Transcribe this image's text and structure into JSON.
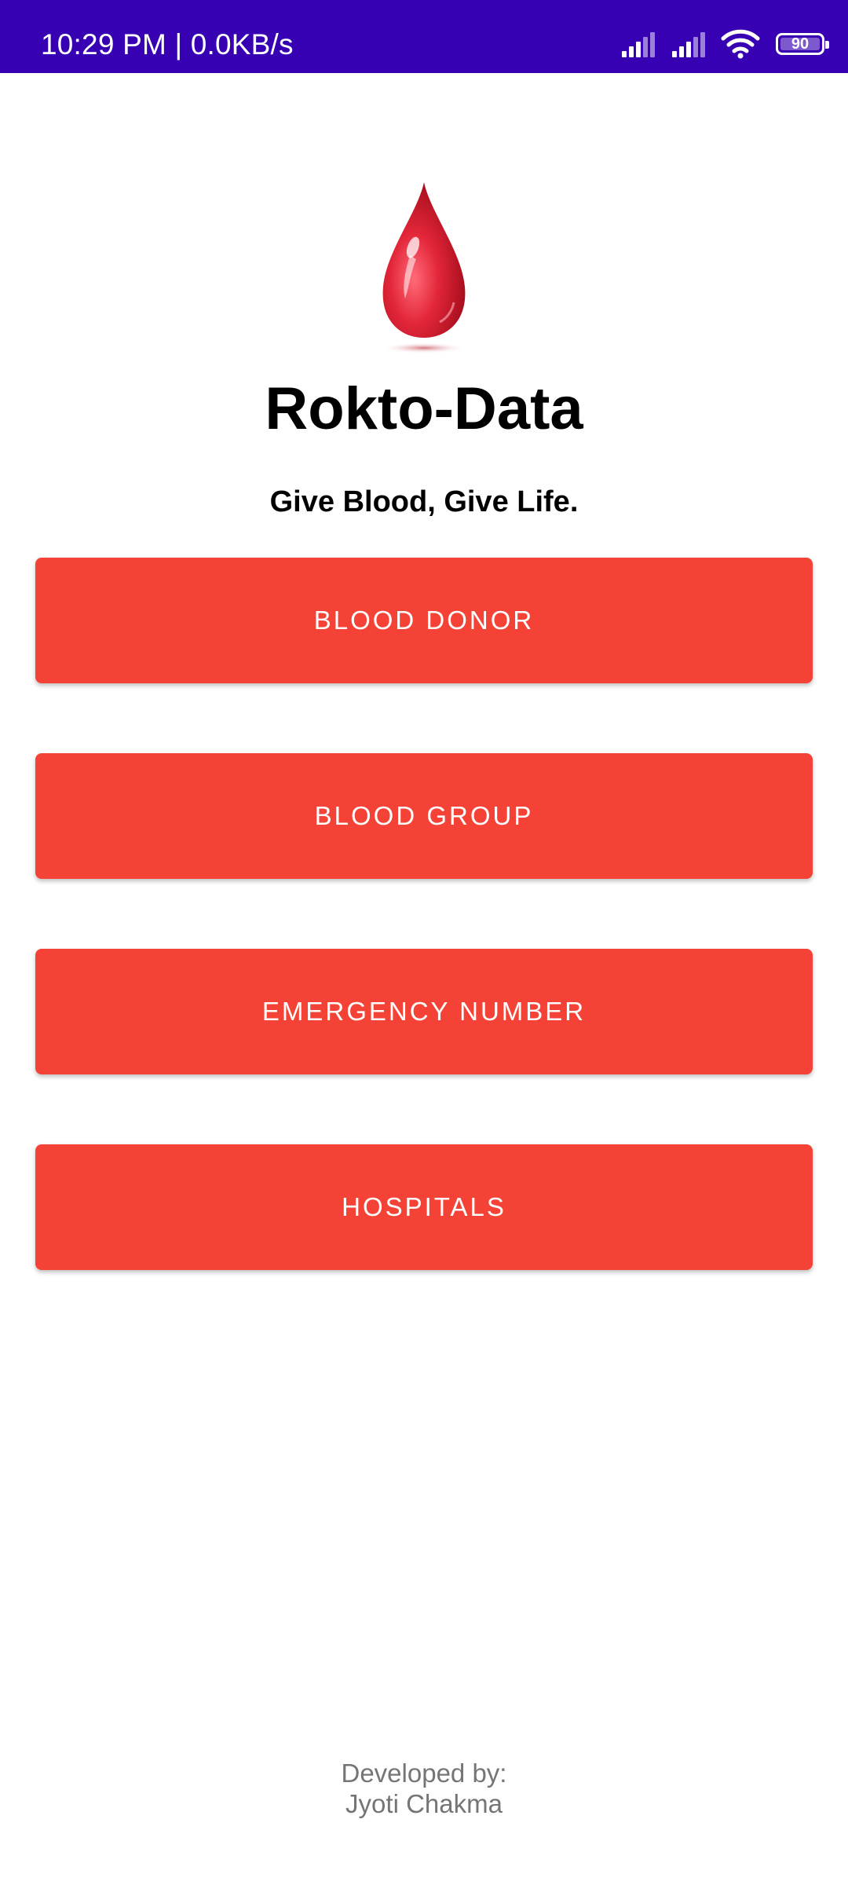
{
  "status_bar": {
    "time": "10:29 PM | 0.0KB/s",
    "battery_level": "90",
    "icons": [
      "signal-icon",
      "signal-icon",
      "wifi-icon",
      "battery-icon"
    ],
    "background": "#3700b3"
  },
  "app": {
    "logo_icon": "blood-drop-icon",
    "title": "Rokto-Data",
    "tagline": "Give Blood, Give Life."
  },
  "menu": {
    "accent_color": "#f44336",
    "buttons": [
      {
        "label": "BLOOD DONOR"
      },
      {
        "label": "BLOOD GROUP"
      },
      {
        "label": "EMERGENCY NUMBER"
      },
      {
        "label": "HOSPITALS"
      }
    ]
  },
  "footer": {
    "line1": "Developed by:",
    "line2": "Jyoti Chakma"
  }
}
